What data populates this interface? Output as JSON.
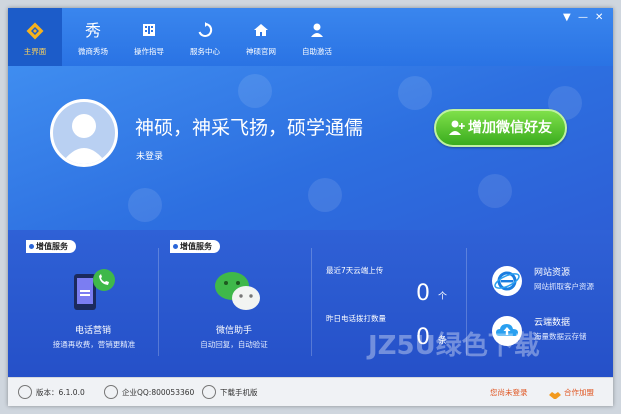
{
  "nav": [
    {
      "label": "主界面",
      "icon": "home-logo-icon",
      "active": true
    },
    {
      "label": "微商秀场",
      "icon": "show-text-icon",
      "glyph": "秀"
    },
    {
      "label": "操作指导",
      "icon": "film-icon"
    },
    {
      "label": "服务中心",
      "icon": "refresh-icon"
    },
    {
      "label": "神硕官网",
      "icon": "house-icon"
    },
    {
      "label": "自助激活",
      "icon": "user-icon"
    }
  ],
  "window_controls": {
    "menu": "▼",
    "minimize": "—",
    "close": "✕"
  },
  "hero": {
    "slogan": "神硕，神采飞扬，硕学通儒",
    "login_status": "未登录",
    "add_button": "增加微信好友"
  },
  "services": [
    {
      "badge": "增值服务",
      "title": "电话营销",
      "subtitle": "接通再收费，营销更精准"
    },
    {
      "badge": "增值服务",
      "title": "微信助手",
      "subtitle": "自动回复，自动验证"
    }
  ],
  "stats": [
    {
      "label": "最近7天云端上传",
      "value": "0",
      "unit": "个"
    },
    {
      "label": "昨日电话拨打数量",
      "value": "0",
      "unit": "条"
    }
  ],
  "resources": [
    {
      "title": "网站资源",
      "subtitle": "网站抓取客户资源",
      "icon": "ie-browser-icon"
    },
    {
      "title": "云端数据",
      "subtitle": "海量数据云存储",
      "icon": "cloud-upload-icon"
    }
  ],
  "statusbar": {
    "version": "版本：6.1.0.0",
    "qq": "企业QQ:800053360",
    "download": "下载手机版",
    "login_warning": "您尚未登录",
    "partner": "合作加盟"
  },
  "watermark": "JZ5U绿色下载",
  "colors": {
    "primary": "#2f6fe0",
    "accent_green": "#4cbe2a",
    "warning": "#e0541f",
    "active_label": "#ffd35a"
  }
}
